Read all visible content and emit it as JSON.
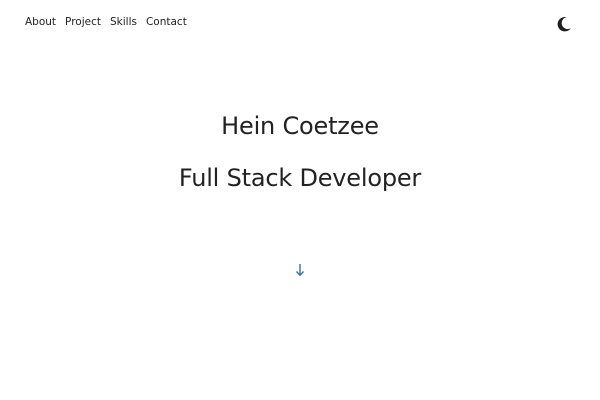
{
  "nav": {
    "items": [
      {
        "label": "About"
      },
      {
        "label": "Project"
      },
      {
        "label": "Skills"
      },
      {
        "label": "Contact"
      }
    ]
  },
  "hero": {
    "name": "Hein Coetzee",
    "role": "Full Stack Developer"
  },
  "icons": {
    "theme_toggle": "moon-icon",
    "scroll_down": "arrow-down-icon"
  },
  "colors": {
    "text": "#222222",
    "background": "#ffffff",
    "accent": "#3a6fa8"
  }
}
